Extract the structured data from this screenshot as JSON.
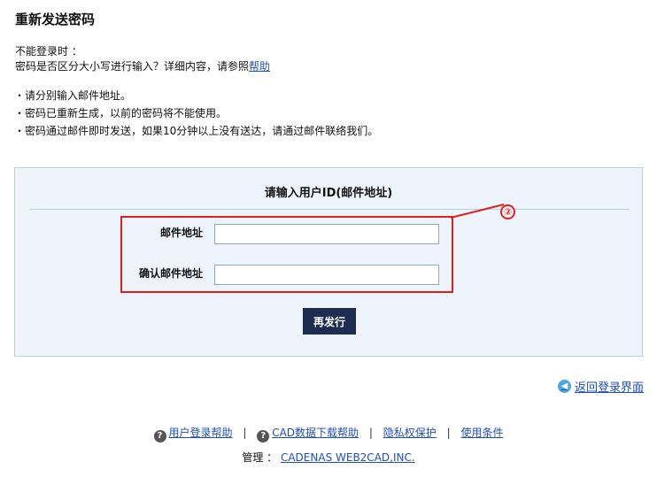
{
  "page": {
    "title": "重新发送密码"
  },
  "intro": {
    "line1": "不能登录时 ：",
    "line2": "密码是否区分大小写进行输入？详细内容，请参照",
    "help_link": "帮助"
  },
  "notes": [
    "・请分别输入邮件地址。",
    "・密码已重新生成，以前的密码将不能使用。",
    "・密码通过邮件即时发送，如果10分钟以上没有送达，请通过邮件联络我们。"
  ],
  "form": {
    "title": "请输入用户ID(邮件地址)",
    "email_label": "邮件地址",
    "email_value": "",
    "confirm_label": "确认邮件地址",
    "confirm_value": "",
    "submit_label": "再发行",
    "callout": "②"
  },
  "back_link": {
    "label": "返回登录界面",
    "icon": "back-arrow-icon"
  },
  "footer": {
    "user_login_help": "用户登录帮助",
    "cad_download_help": "CAD数据下载帮助",
    "privacy": "隐私权保护",
    "terms": "使用条件",
    "separator": "|",
    "admin_label": "管理 ：",
    "admin_link": "CADENAS WEB2CAD,INC."
  },
  "colors": {
    "accent_red": "#e02020",
    "link_blue": "#1f4fbf",
    "panel_bg": "#eef4fb",
    "button_bg": "#1c2d4f"
  }
}
